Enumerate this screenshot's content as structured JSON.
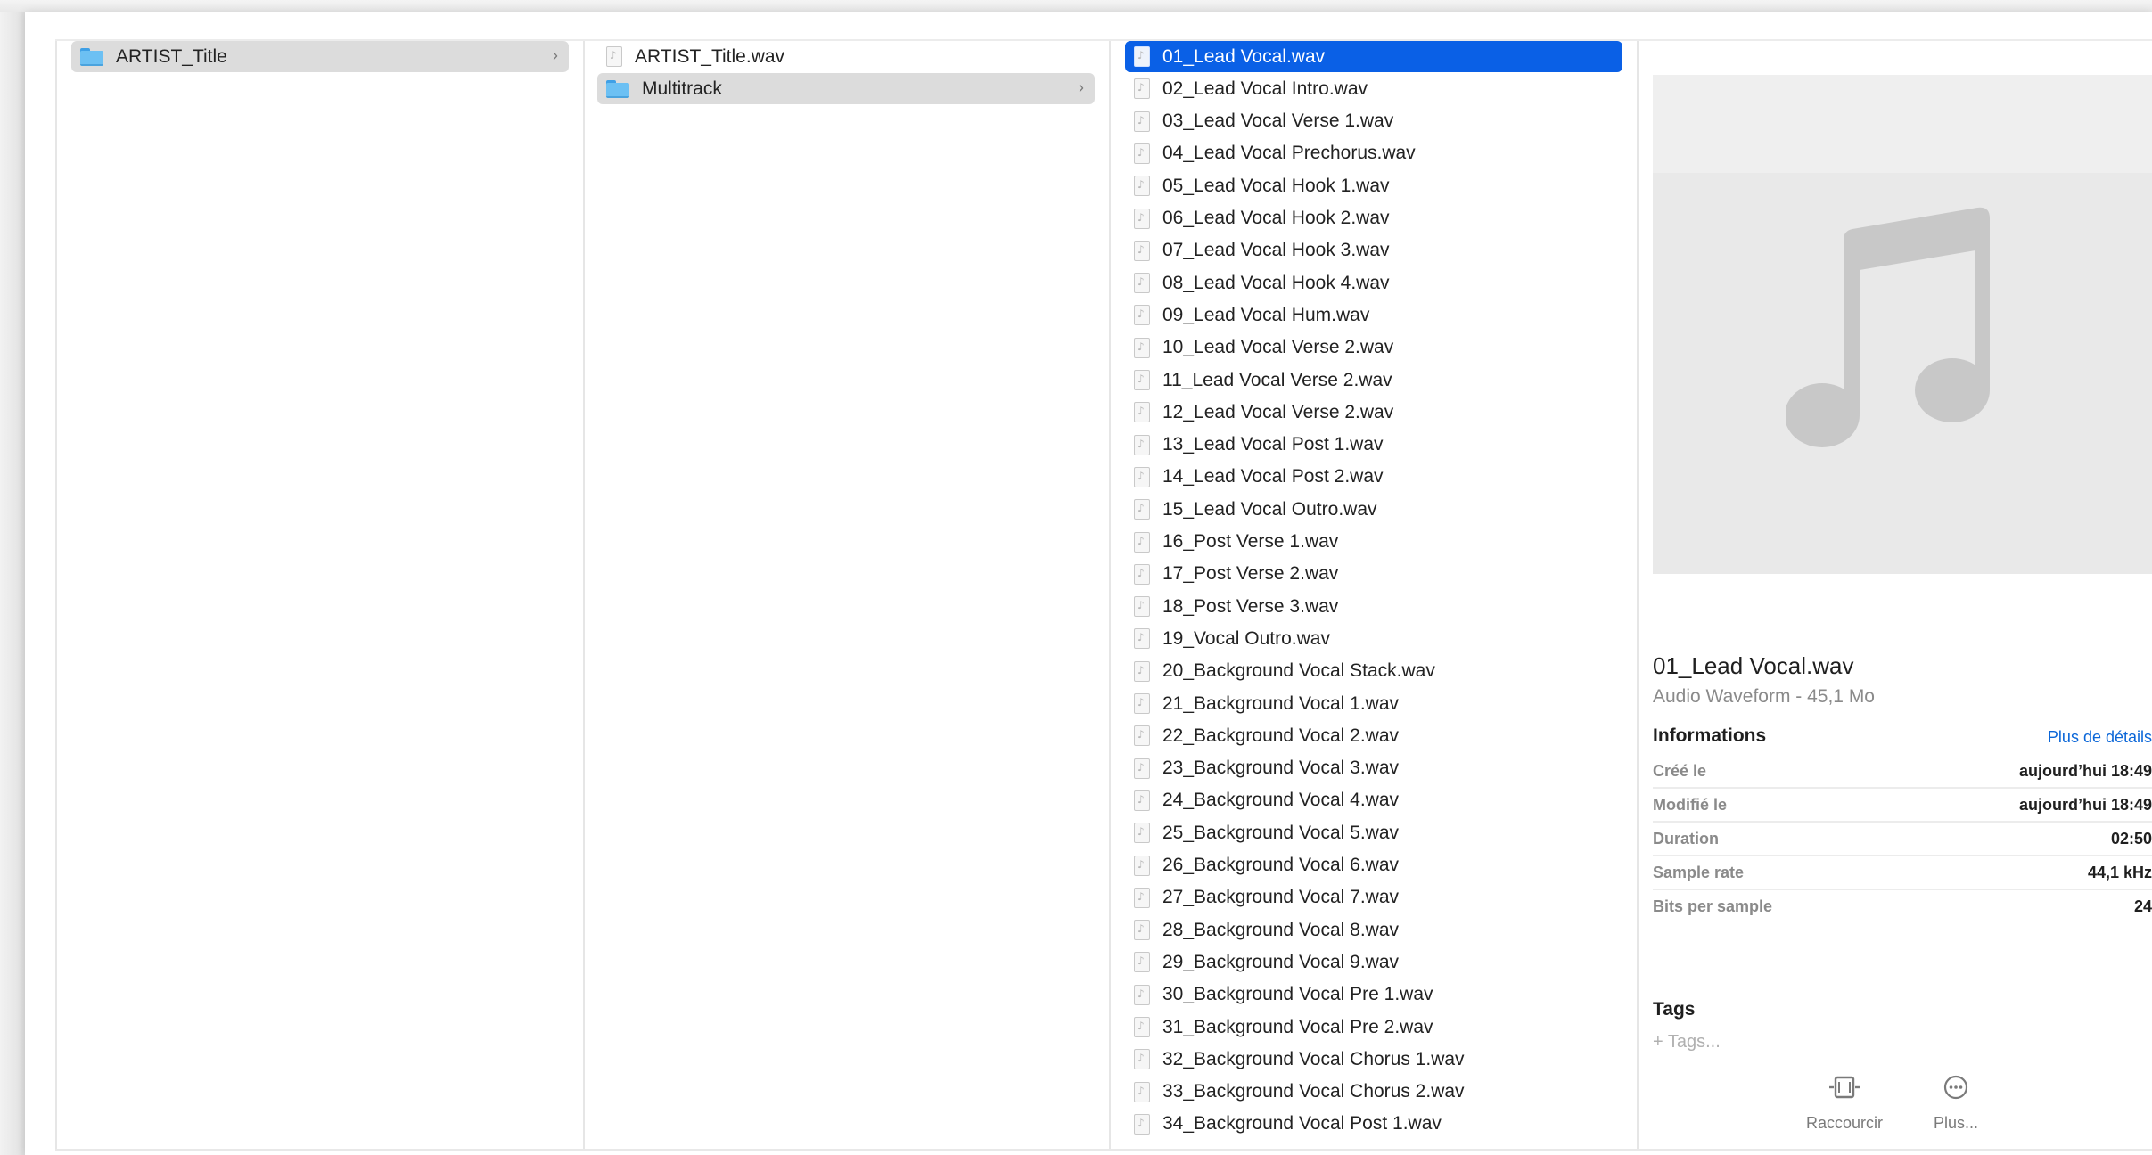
{
  "column1": {
    "items": [
      {
        "name": "ARTIST_Title",
        "kind": "folder",
        "selected": true
      }
    ]
  },
  "column2": {
    "items": [
      {
        "name": "ARTIST_Title.wav",
        "kind": "file"
      },
      {
        "name": "Multitrack",
        "kind": "folder",
        "selected": true
      }
    ]
  },
  "column3": {
    "files": [
      "01_Lead Vocal.wav",
      "02_Lead Vocal Intro.wav",
      "03_Lead Vocal Verse 1.wav",
      "04_Lead Vocal Prechorus.wav",
      "05_Lead Vocal Hook 1.wav",
      "06_Lead Vocal Hook 2.wav",
      "07_Lead Vocal Hook 3.wav",
      "08_Lead Vocal Hook 4.wav",
      "09_Lead Vocal Hum.wav",
      "10_Lead Vocal Verse 2.wav",
      "11_Lead Vocal Verse 2.wav",
      "12_Lead Vocal Verse 2.wav",
      "13_Lead Vocal Post 1.wav",
      "14_Lead Vocal Post 2.wav",
      "15_Lead Vocal Outro.wav",
      "16_Post Verse 1.wav",
      "17_Post Verse 2.wav",
      "18_Post Verse 3.wav",
      "19_Vocal Outro.wav",
      "20_Background Vocal Stack.wav",
      "21_Background Vocal 1.wav",
      "22_Background Vocal 2.wav",
      "23_Background Vocal 3.wav",
      "24_Background Vocal 4.wav",
      "25_Background Vocal 5.wav",
      "26_Background Vocal 6.wav",
      "27_Background Vocal 7.wav",
      "28_Background Vocal 8.wav",
      "29_Background Vocal 9.wav",
      "30_Background Vocal Pre 1.wav",
      "31_Background Vocal Pre 2.wav",
      "32_Background Vocal Chorus 1.wav",
      "33_Background Vocal Chorus 2.wav",
      "34_Background Vocal Post 1.wav"
    ],
    "selected_index": 0
  },
  "preview": {
    "icon": "music-note-icon",
    "title": "01_Lead Vocal.wav",
    "subtitle": "Audio Waveform - 45,1 Mo",
    "info_heading": "Informations",
    "more_details": "Plus de détails",
    "info": [
      {
        "label": "Créé le",
        "value": "aujourd’hui 18:49"
      },
      {
        "label": "Modifié le",
        "value": "aujourd’hui 18:49"
      },
      {
        "label": "Duration",
        "value": "02:50"
      },
      {
        "label": "Sample rate",
        "value": "44,1 kHz"
      },
      {
        "label": "Bits per sample",
        "value": "24"
      }
    ],
    "tags_heading": "Tags",
    "tags_placeholder": "+ Tags...",
    "actions": [
      {
        "label": "Raccourcir",
        "icon": "trim-icon"
      },
      {
        "label": "Plus...",
        "icon": "more-icon"
      }
    ]
  },
  "colors": {
    "selection_blue": "#0a60e6",
    "selection_gray": "#dcdcdc",
    "link_blue": "#0a66d8",
    "folder_blue": "#6cc0f3"
  }
}
